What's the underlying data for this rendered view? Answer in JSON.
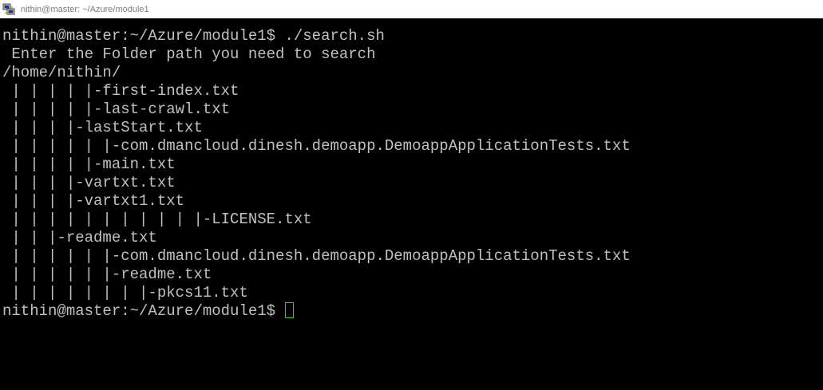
{
  "window": {
    "title": "nithin@master: ~/Azure/module1",
    "icon": "putty-icon"
  },
  "terminal": {
    "lines": [
      "nithin@master:~/Azure/module1$ ./search.sh",
      " Enter the Folder path you need to search",
      "/home/nithin/",
      " | | | | |-first-index.txt",
      " | | | | |-last-crawl.txt",
      " | | | |-lastStart.txt",
      " | | | | | |-com.dmancloud.dinesh.demoapp.DemoappApplicationTests.txt",
      " | | | | |-main.txt",
      " | | | |-vartxt.txt",
      " | | | |-vartxt1.txt",
      " | | | | | | | | | | |-LICENSE.txt",
      " | | |-readme.txt",
      " | | | | | |-com.dmancloud.dinesh.demoapp.DemoappApplicationTests.txt",
      " | | | | | |-readme.txt",
      " | | | | | | | |-pkcs11.txt"
    ],
    "prompt": "nithin@master:~/Azure/module1$ ",
    "cursor_color": "#33cc33",
    "text_color": "#c0c0c0",
    "background_color": "#000000"
  }
}
